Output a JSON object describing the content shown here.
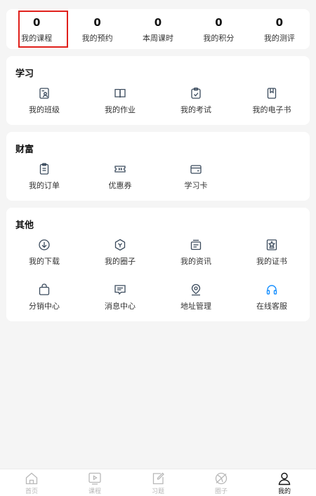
{
  "stats": [
    {
      "value": "0",
      "label": "我的课程"
    },
    {
      "value": "0",
      "label": "我的预约"
    },
    {
      "value": "0",
      "label": "本周课时"
    },
    {
      "value": "0",
      "label": "我的积分"
    },
    {
      "value": "0",
      "label": "我的测评"
    }
  ],
  "study": {
    "title": "学习",
    "items": [
      {
        "label": "我的班级",
        "icon": "class-icon"
      },
      {
        "label": "我的作业",
        "icon": "homework-icon"
      },
      {
        "label": "我的考试",
        "icon": "exam-icon"
      },
      {
        "label": "我的电子书",
        "icon": "ebook-icon"
      }
    ]
  },
  "wealth": {
    "title": "财富",
    "items": [
      {
        "label": "我的订单",
        "icon": "order-icon"
      },
      {
        "label": "优惠券",
        "icon": "coupon-icon"
      },
      {
        "label": "学习卡",
        "icon": "study-card-icon"
      }
    ]
  },
  "other": {
    "title": "其他",
    "items": [
      {
        "label": "我的下载",
        "icon": "download-icon"
      },
      {
        "label": "我的圈子",
        "icon": "circle-icon"
      },
      {
        "label": "我的资讯",
        "icon": "news-icon"
      },
      {
        "label": "我的证书",
        "icon": "certificate-icon"
      },
      {
        "label": "分销中心",
        "icon": "distribution-icon"
      },
      {
        "label": "消息中心",
        "icon": "message-icon"
      },
      {
        "label": "地址管理",
        "icon": "location-icon"
      },
      {
        "label": "在线客服",
        "icon": "headset-icon"
      }
    ]
  },
  "nav": [
    {
      "label": "首页",
      "icon": "home-icon"
    },
    {
      "label": "课程",
      "icon": "course-icon"
    },
    {
      "label": "习题",
      "icon": "exercise-icon"
    },
    {
      "label": "圈子",
      "icon": "circle-nav-icon"
    },
    {
      "label": "我的",
      "icon": "profile-icon",
      "active": true
    }
  ],
  "colors": {
    "background": "#f5f5f5",
    "card": "#ffffff",
    "icon": "#3a4a5c",
    "highlight": "#e0201b",
    "nav_inactive": "#b8b8b8",
    "nav_active": "#111111"
  }
}
